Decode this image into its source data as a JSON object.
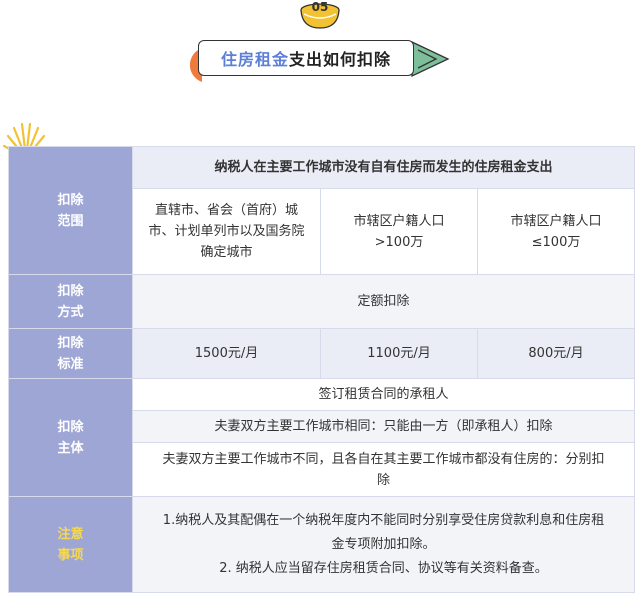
{
  "badge": {
    "number": "05"
  },
  "title": {
    "highlight": "住房租金",
    "rest": "支出如何扣除"
  },
  "colors": {
    "row_header_bg": "#9ea6d6",
    "accent_blue": "#5d7fd6",
    "badge_yellow": "#f3c233",
    "orange": "#f07a3c",
    "green": "#7dbf9a",
    "note_yellow": "#f7d94c"
  },
  "table": {
    "range": {
      "header_label": [
        "扣除",
        "范围"
      ],
      "banner": "纳税人在主要工作城市没有自有住房而发生的住房租金支出",
      "cities": [
        [
          "直辖市、省会（首府）城",
          "市、计划单列市以及国务院",
          "确定城市"
        ],
        [
          "市辖区户籍人口",
          ">100万"
        ],
        [
          "市辖区户籍人口",
          "≤100万"
        ]
      ]
    },
    "method": {
      "header_label": [
        "扣除",
        "方式"
      ],
      "value": "定额扣除"
    },
    "standard": {
      "header_label": [
        "扣除",
        "标准"
      ],
      "values": [
        "1500元/月",
        "1100元/月",
        "800元/月"
      ]
    },
    "subject": {
      "header_label": [
        "扣除",
        "主体"
      ],
      "lines": [
        [
          "签订租赁合同的承租人"
        ],
        [
          "夫妻双方主要工作城市相同：只能由一方（即承租人）扣除"
        ],
        [
          "夫妻双方主要工作城市不同，且各自在其主要工作城市都没有住房的：分别扣",
          "除"
        ]
      ]
    },
    "notes": {
      "header_label": [
        "注意",
        "事项"
      ],
      "lines": [
        "1.纳税人及其配偶在一个纳税年度内不能同时分别享受住房贷款利息和住房租",
        "金专项附加扣除。",
        "2. 纳税人应当留存住房租赁合同、协议等有关资料备查。"
      ]
    }
  }
}
